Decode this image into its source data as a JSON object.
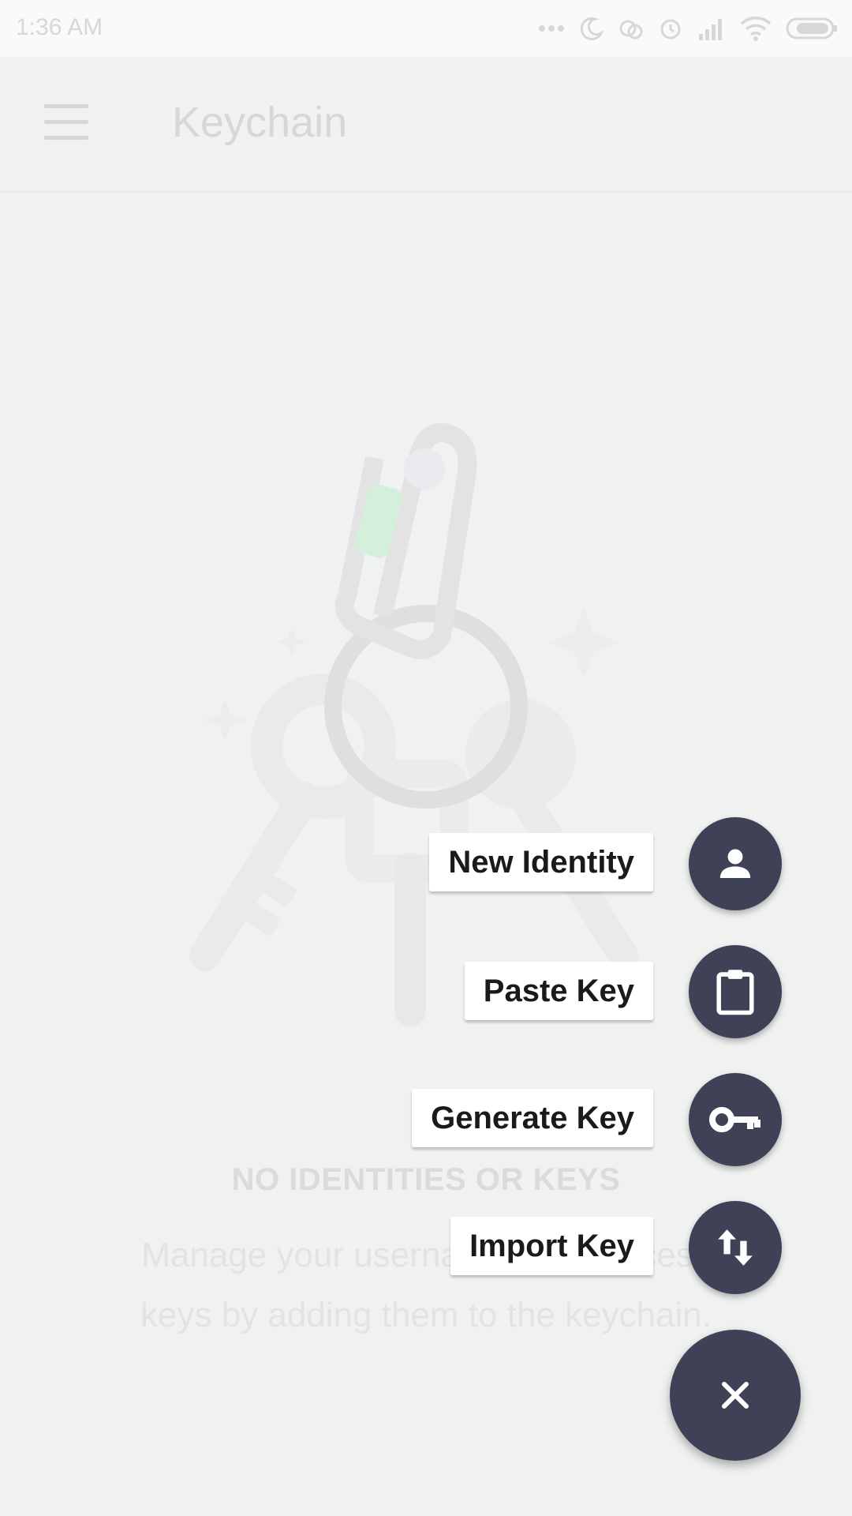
{
  "status": {
    "time": "1:36 AM",
    "icons": [
      "more-dots-icon",
      "moon-icon",
      "sync-icon",
      "alarm-icon",
      "signal-icon",
      "wifi-icon",
      "battery-icon"
    ]
  },
  "appbar": {
    "title": "Keychain",
    "menu_icon": "hamburger-menu-icon"
  },
  "empty_state": {
    "title": "NO IDENTITIES OR KEYS",
    "description_line1": "Manage your usernames and access",
    "description_line2": "keys by adding them to the keychain."
  },
  "fab_menu": {
    "items": [
      {
        "label": "New Identity",
        "icon": "person-icon"
      },
      {
        "label": "Paste Key",
        "icon": "clipboard-icon"
      },
      {
        "label": "Generate Key",
        "icon": "key-icon"
      },
      {
        "label": "Import Key",
        "icon": "import-export-icon"
      }
    ],
    "close_icon": "close-icon"
  },
  "colors": {
    "fab": "#3f4257",
    "background": "#f0f1f1",
    "accent_green": "#bff0cf"
  }
}
